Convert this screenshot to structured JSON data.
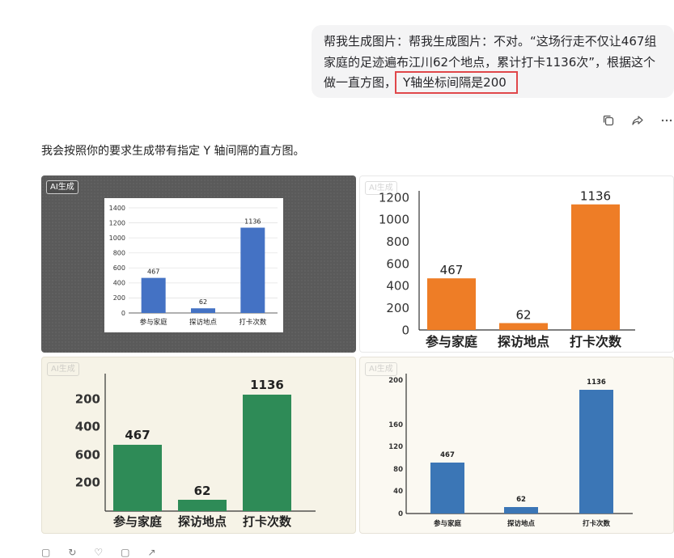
{
  "user_message": {
    "text": "帮我生成图片：帮我生成图片：不对。“这场行走不仅让467组家庭的足迹遍布江川62个地点，累计打卡1136次”，根据这个做一直方图，",
    "highlight": "Y轴坐标间隔是200"
  },
  "message_actions": [
    "copy-icon",
    "share-icon",
    "more-icon"
  ],
  "reply_text": "我会按照你的要求生成带有指定 Y 轴间隔的直方图。",
  "badge_label": "AI生成",
  "bottom_actions": [
    "copy-icon",
    "regenerate-icon",
    "like-icon",
    "dislike-icon",
    "share-icon"
  ],
  "colors": {
    "blue": "#4472c4",
    "orange": "#ee7d26",
    "green": "#2e8b57",
    "steel_blue": "#3b76b6",
    "highlight_border": "#e0474a"
  },
  "chart_data": [
    {
      "type": "bar",
      "categories": [
        "参与家庭",
        "探访地点",
        "打卡次数"
      ],
      "values": [
        467,
        62,
        1136
      ],
      "data_labels": [
        "467",
        "62",
        "1136"
      ],
      "ylim": [
        0,
        1400
      ],
      "yticks": [
        "0",
        "200",
        "400",
        "600",
        "800",
        "1000",
        "1200",
        "1400"
      ],
      "grid": true,
      "color": "#4472c4"
    },
    {
      "type": "bar",
      "categories": [
        "参与家庭",
        "探访地点",
        "打卡次数"
      ],
      "values": [
        467,
        62,
        1136
      ],
      "data_labels": [
        "467",
        "62",
        "1136"
      ],
      "ylim": [
        0,
        1200
      ],
      "yticks": [
        "0",
        "200",
        "400",
        "600",
        "800",
        "1000",
        "1200"
      ],
      "grid": false,
      "color": "#ee7d26"
    },
    {
      "type": "bar",
      "categories": [
        "参与家庭",
        "探访地点",
        "打卡次数"
      ],
      "values": [
        467,
        62,
        1136
      ],
      "data_labels": [
        "467",
        "62",
        "1136"
      ],
      "yticks": [
        "200",
        "400",
        "600",
        "200"
      ],
      "grid": false,
      "color": "#2e8b57"
    },
    {
      "type": "bar",
      "categories": [
        "参与家庭",
        "探访地点",
        "打卡次数"
      ],
      "values": [
        467,
        62,
        1136
      ],
      "data_labels": [
        "467",
        "62",
        "1136"
      ],
      "yticks": [
        "0",
        "40",
        "80",
        "120",
        "160",
        "200"
      ],
      "grid": false,
      "color": "#3b76b6"
    }
  ]
}
